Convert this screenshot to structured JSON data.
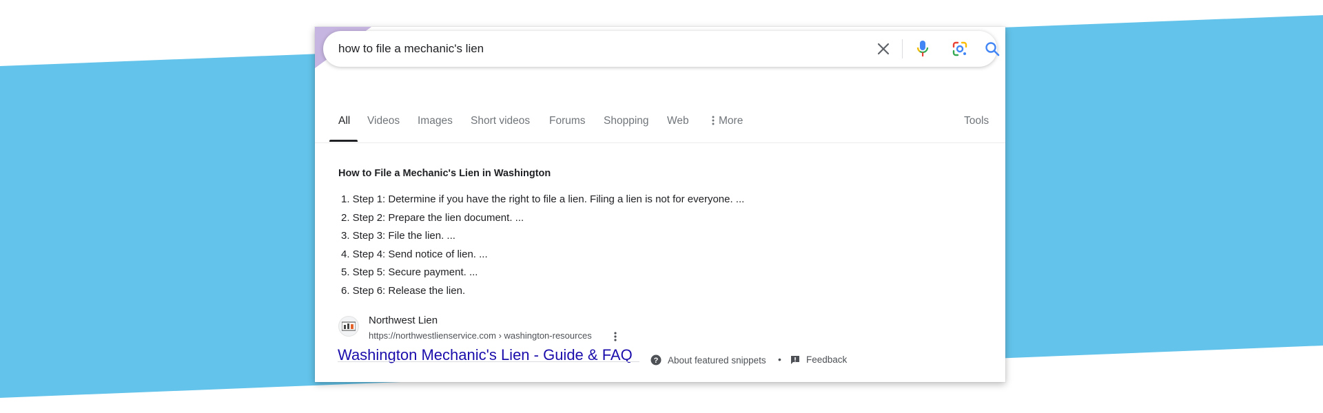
{
  "colors": {
    "background_band": "#63c3ea",
    "card_corner_accent": "#c6b5e0",
    "link": "#1a0dab",
    "mic_blue": "#4285f4",
    "mic_red": "#ea4335",
    "mic_yellow": "#fbbc04",
    "mic_green": "#34a853"
  },
  "search": {
    "query": "how to file a mechanic's lien",
    "icons": [
      "close-icon",
      "microphone-icon",
      "lens-icon",
      "search-icon"
    ]
  },
  "tabs": [
    {
      "label": "All",
      "active": true
    },
    {
      "label": "Videos"
    },
    {
      "label": "Images"
    },
    {
      "label": "Short videos"
    },
    {
      "label": "Forums"
    },
    {
      "label": "Shopping"
    },
    {
      "label": "Web"
    },
    {
      "label": "More",
      "icon": "vertical-dots-icon"
    }
  ],
  "tools_label": "Tools",
  "snippet": {
    "title": "How to File a Mechanic's Lien in Washington",
    "steps": [
      "1. Step 1: Determine if you have the right to file a lien. Filing a lien is not for everyone. ...",
      "2. Step 2: Prepare the lien document. ...",
      "3. Step 3: File the lien. ...",
      "4. Step 4: Send notice of lien. ...",
      "5. Step 5: Secure payment. ...",
      "6. Step 6: Release the lien."
    ]
  },
  "source": {
    "name": "Northwest Lien",
    "url": "https://northwestlienservice.com › washington-resources",
    "favicon": "northwest-lien-favicon-icon",
    "title": "Washington Mechanic's Lien - Guide & FAQ"
  },
  "footer": {
    "about_label": "About featured snippets",
    "separator": "•",
    "feedback_label": "Feedback"
  }
}
